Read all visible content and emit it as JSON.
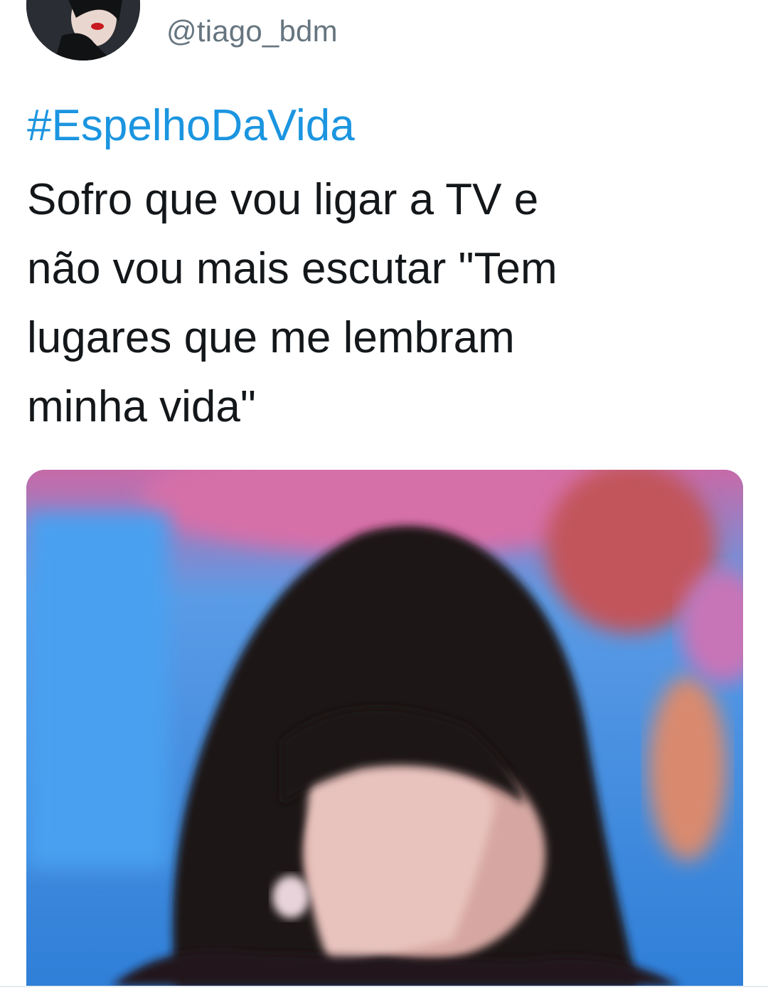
{
  "tweet": {
    "handle": "@tiago_bdm",
    "hashtag": "#EspelhoDaVida",
    "text_lines": [
      "Sofro que vou ligar a TV e",
      "não vou mais escutar \"Tem",
      "lugares que me lembram",
      "minha vida\""
    ]
  },
  "colors": {
    "hashtag": "#1b95e0",
    "handle": "#66757f",
    "text": "#14171a"
  },
  "media": {
    "kind": "photo",
    "icon": "photo-woman-covering-face"
  }
}
